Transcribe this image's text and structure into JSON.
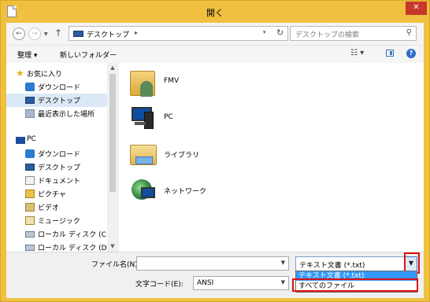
{
  "window": {
    "title": "開く",
    "close_label": "✕"
  },
  "nav_buttons": {
    "back": "←",
    "forward": "→",
    "recent": "▼",
    "up": "↑"
  },
  "address": {
    "path": "デスクトップ",
    "separator": "▸",
    "dropdown": "▾",
    "refresh": "↻"
  },
  "search": {
    "placeholder": "デスクトップの検索",
    "icon": "⚲"
  },
  "toolbar": {
    "organize": "整理 ▾",
    "new_folder": "新しいフォルダー",
    "views": "☷ ▾",
    "help": "?"
  },
  "nav_pane": {
    "items": [
      {
        "label": "お気に入り",
        "icon": "star-icon"
      },
      {
        "label": "ダウンロード",
        "icon": "downloads-icon"
      },
      {
        "label": "デスクトップ",
        "icon": "desktop-icon",
        "selected": true
      },
      {
        "label": "最近表示した場所",
        "icon": "recent-places-icon"
      },
      {
        "label": "PC",
        "icon": "pc-icon"
      },
      {
        "label": "ダウンロード",
        "icon": "downloads-icon"
      },
      {
        "label": "デスクトップ",
        "icon": "desktop-icon"
      },
      {
        "label": "ドキュメント",
        "icon": "documents-icon"
      },
      {
        "label": "ピクチャ",
        "icon": "pictures-icon"
      },
      {
        "label": "ビデオ",
        "icon": "videos-icon"
      },
      {
        "label": "ミュージック",
        "icon": "music-icon"
      },
      {
        "label": "ローカル ディスク (C:)",
        "icon": "drive-icon"
      },
      {
        "label": "ローカル ディスク (D:)",
        "icon": "drive-icon"
      }
    ]
  },
  "content": {
    "items": [
      {
        "label": "FMV",
        "icon": "user-folder-icon"
      },
      {
        "label": "PC",
        "icon": "computer-icon"
      },
      {
        "label": "ライブラリ",
        "icon": "libraries-icon"
      },
      {
        "label": "ネットワーク",
        "icon": "network-icon"
      }
    ]
  },
  "bottom": {
    "filename_label": "ファイル名(N):",
    "filename_value": "",
    "filetype_selected": "テキスト文書 (*.txt)",
    "filetype_options": [
      "テキスト文書 (*.txt)",
      "すべてのファイル"
    ],
    "encoding_label": "文字コード(E):",
    "encoding_value": "ANSI"
  },
  "colors": {
    "frame": "#f0c040",
    "close": "#c7392b",
    "selection": "#3399ff",
    "highlight_box": "#e01010"
  }
}
